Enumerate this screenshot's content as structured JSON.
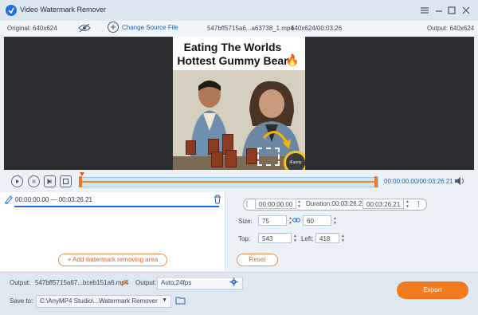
{
  "window": {
    "title": "Video Watermark Remover"
  },
  "info": {
    "original": "Original: 640x624",
    "change_source": "Change Source File",
    "filename": "547bff5715a6...a63738_1.mp4",
    "dims_time": "640x624/00:03:26",
    "output": "Output: 640x624"
  },
  "preview": {
    "caption_line1": "Eating The Worlds",
    "caption_line2": "Hottest Gummy Bear",
    "logo_text": "iFunny"
  },
  "timeline": {
    "time_readout": "00:00:00.00/00:03:26.21"
  },
  "segment": {
    "range": "00:00:00.00 — 00:03:26.21"
  },
  "add_area_label": "Add watermark removing area",
  "range": {
    "start": "00:00:00.00",
    "duration": "Duration:00:03:26.21",
    "end": "00:03:26.21"
  },
  "size": {
    "label": "Size:",
    "width": "75",
    "height": "60"
  },
  "position": {
    "top_label": "Top:",
    "top": "543",
    "left_label": "Left:",
    "left": "418"
  },
  "reset_label": "Reset",
  "bottom": {
    "output_label": "Output:",
    "output_file": "547bff5715a67...bceb151a6.mp4",
    "format_label": "Output:",
    "format_value": "Auto;24fps",
    "save_label": "Save to:",
    "save_path": "C:\\AnyMP4 Studio\\...Watermark Remover",
    "export_label": "Export"
  },
  "colors": {
    "accent": "#f47b20",
    "blue": "#1f6fe0",
    "dark_bg": "#2b2d30"
  }
}
